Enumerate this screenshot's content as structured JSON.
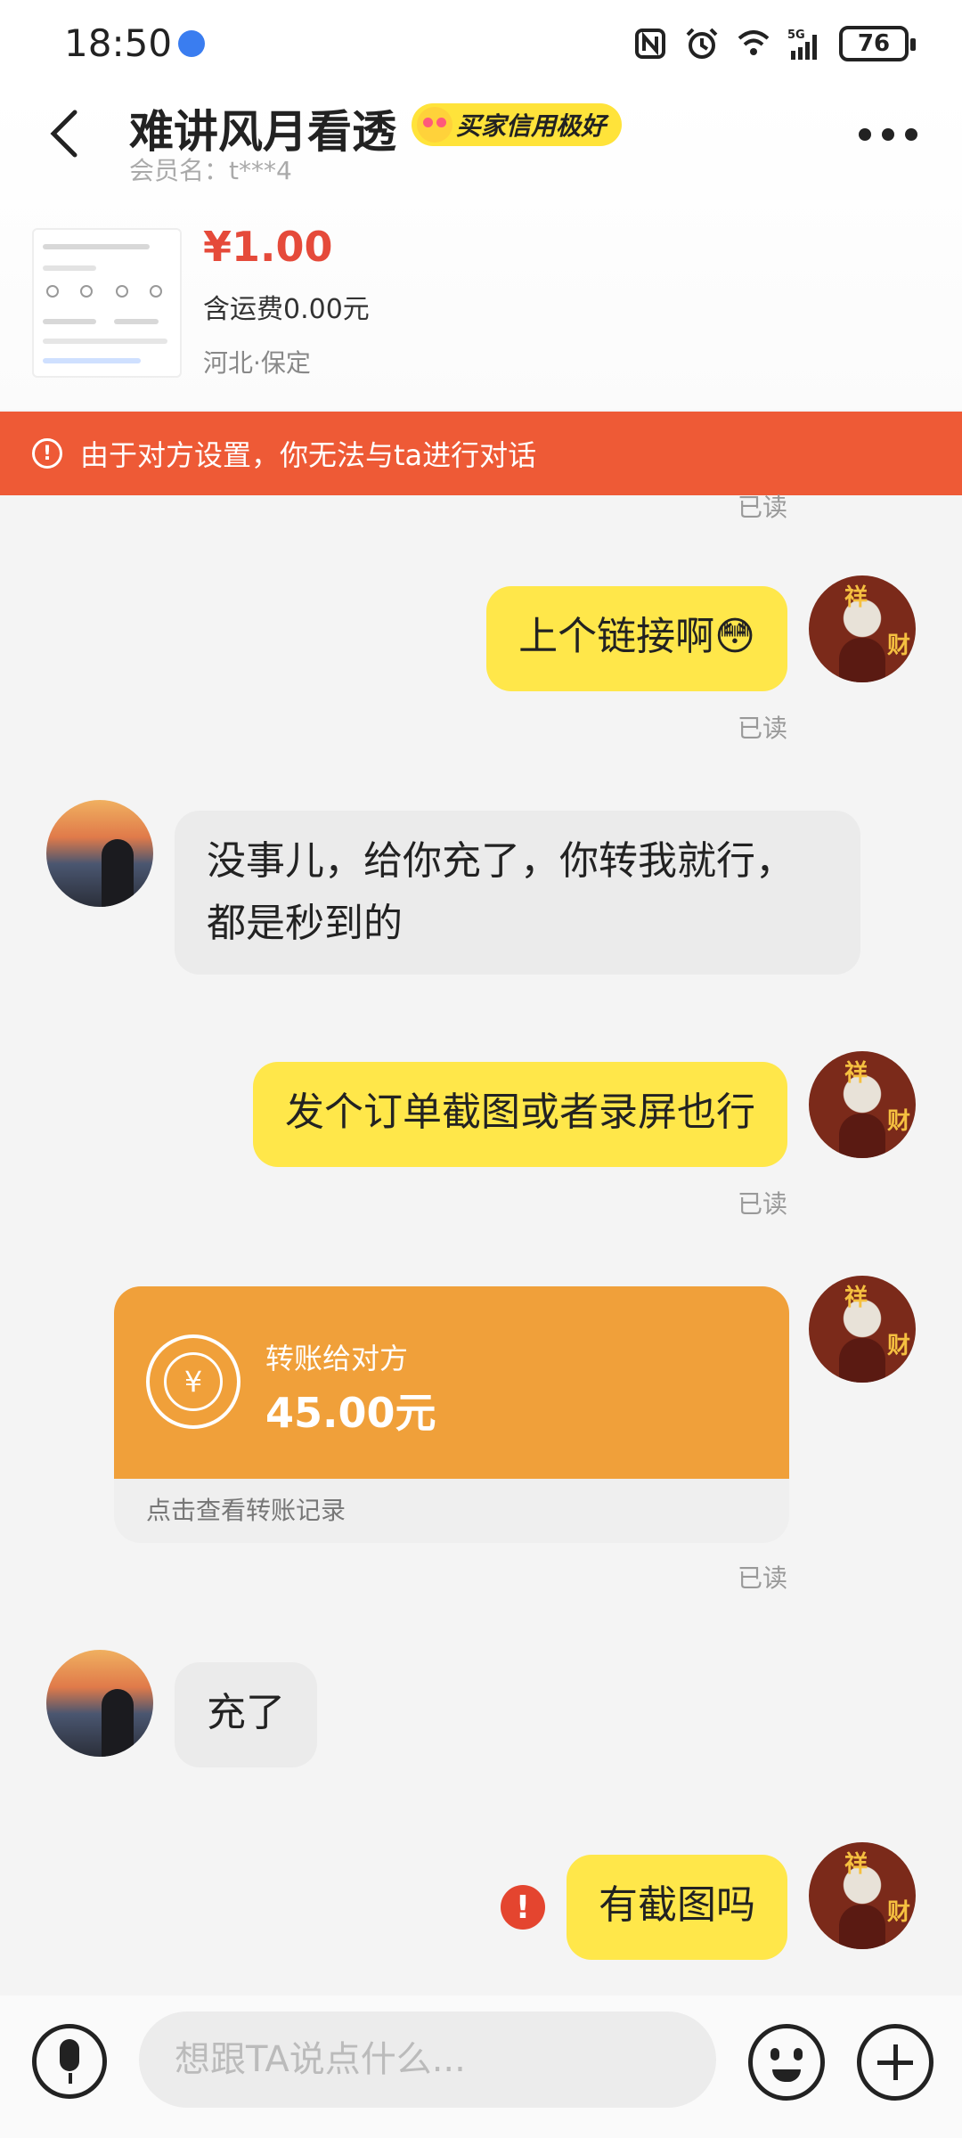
{
  "status_bar": {
    "time": "18:50",
    "battery": "76"
  },
  "header": {
    "title": "难讲风月看透",
    "badge": "买家信用极好",
    "member": "会员名：t***4"
  },
  "product": {
    "price": "¥1.00",
    "shipping": "含运费0.00元",
    "location": "河北·保定"
  },
  "warning": "由于对方设置，你无法与ta进行对话",
  "messages": {
    "read_label": "已读",
    "m1": "上个链接啊😳",
    "m2": "没事儿，给你充了，你转我就行，都是秒到的",
    "m3": "发个订单截图或者录屏也行",
    "transfer": {
      "label": "转账给对方",
      "amount": "45.00元",
      "footer": "点击查看转账记录",
      "currency_glyph": "¥"
    },
    "m4": "充了",
    "m5": "有截图吗"
  },
  "input": {
    "placeholder": "想跟TA说点什么..."
  },
  "colors": {
    "accent_yellow": "#ffe74a",
    "warning_red": "#ee5a36",
    "transfer_orange": "#f0a03a",
    "price_red": "#e54a3a"
  },
  "icons": [
    "back-arrow-icon",
    "more-icon",
    "warning-icon",
    "transfer-icon",
    "error-icon",
    "mic-icon",
    "emoji-icon",
    "plus-icon"
  ]
}
